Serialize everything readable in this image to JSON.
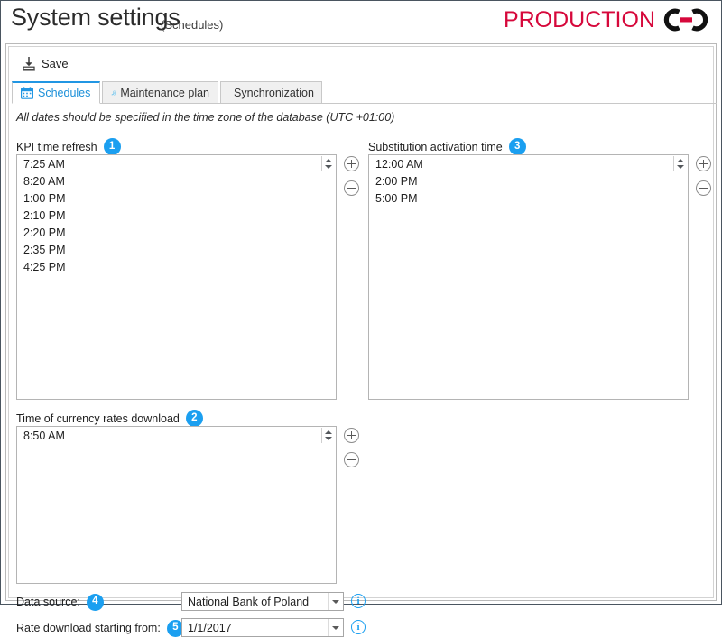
{
  "window": {
    "title": "System settings",
    "subtitle": "(Schedules)"
  },
  "logo": {
    "text": "PRODUCTION",
    "mark_name": "interlocking-rings-logo",
    "text_color": "#d6083b",
    "mark_color": "#111111",
    "mark_accent_color": "#d6083b"
  },
  "toolbar": {
    "save_label": "Save",
    "save_icon": "save-icon"
  },
  "tabs": [
    {
      "label": "Schedules",
      "icon": "calendar-icon",
      "active": true
    },
    {
      "label": "Maintenance plan",
      "icon": "wrench-clock-icon",
      "active": false
    },
    {
      "label": "Synchronization",
      "icon": "calendar-sync-icon",
      "active": false
    }
  ],
  "content": {
    "timezone_note": "All dates should be specified in the time zone of the database (UTC +01:00)",
    "groups": {
      "kpi_time_refresh": {
        "label": "KPI time refresh",
        "badge": "1",
        "items": [
          "7:25 AM",
          "8:20 AM",
          "1:00 PM",
          "2:10 PM",
          "2:20 PM",
          "2:35 PM",
          "4:25 PM"
        ],
        "add_label": "+",
        "remove_label": "−"
      },
      "substitution_activation_time": {
        "label": "Substitution activation time",
        "badge": "3",
        "items": [
          "12:00 AM",
          "2:00 PM",
          "5:00 PM"
        ],
        "add_label": "+",
        "remove_label": "−"
      },
      "currency_rates_download": {
        "label": "Time of currency rates download",
        "badge": "2",
        "items": [
          "8:50 AM"
        ],
        "add_label": "+",
        "remove_label": "−"
      }
    },
    "form": {
      "data_source": {
        "label": "Data source:",
        "badge": "4",
        "value": "National Bank of Poland",
        "info_label": "i"
      },
      "rate_download_starting_from": {
        "label": "Rate download starting from:",
        "badge": "5",
        "value": "1/1/2017",
        "info_label": "i"
      }
    }
  },
  "theme": {
    "accent": "#1b9ff0",
    "tab_active": "#2196e3",
    "frame_border": "#4a5560"
  }
}
